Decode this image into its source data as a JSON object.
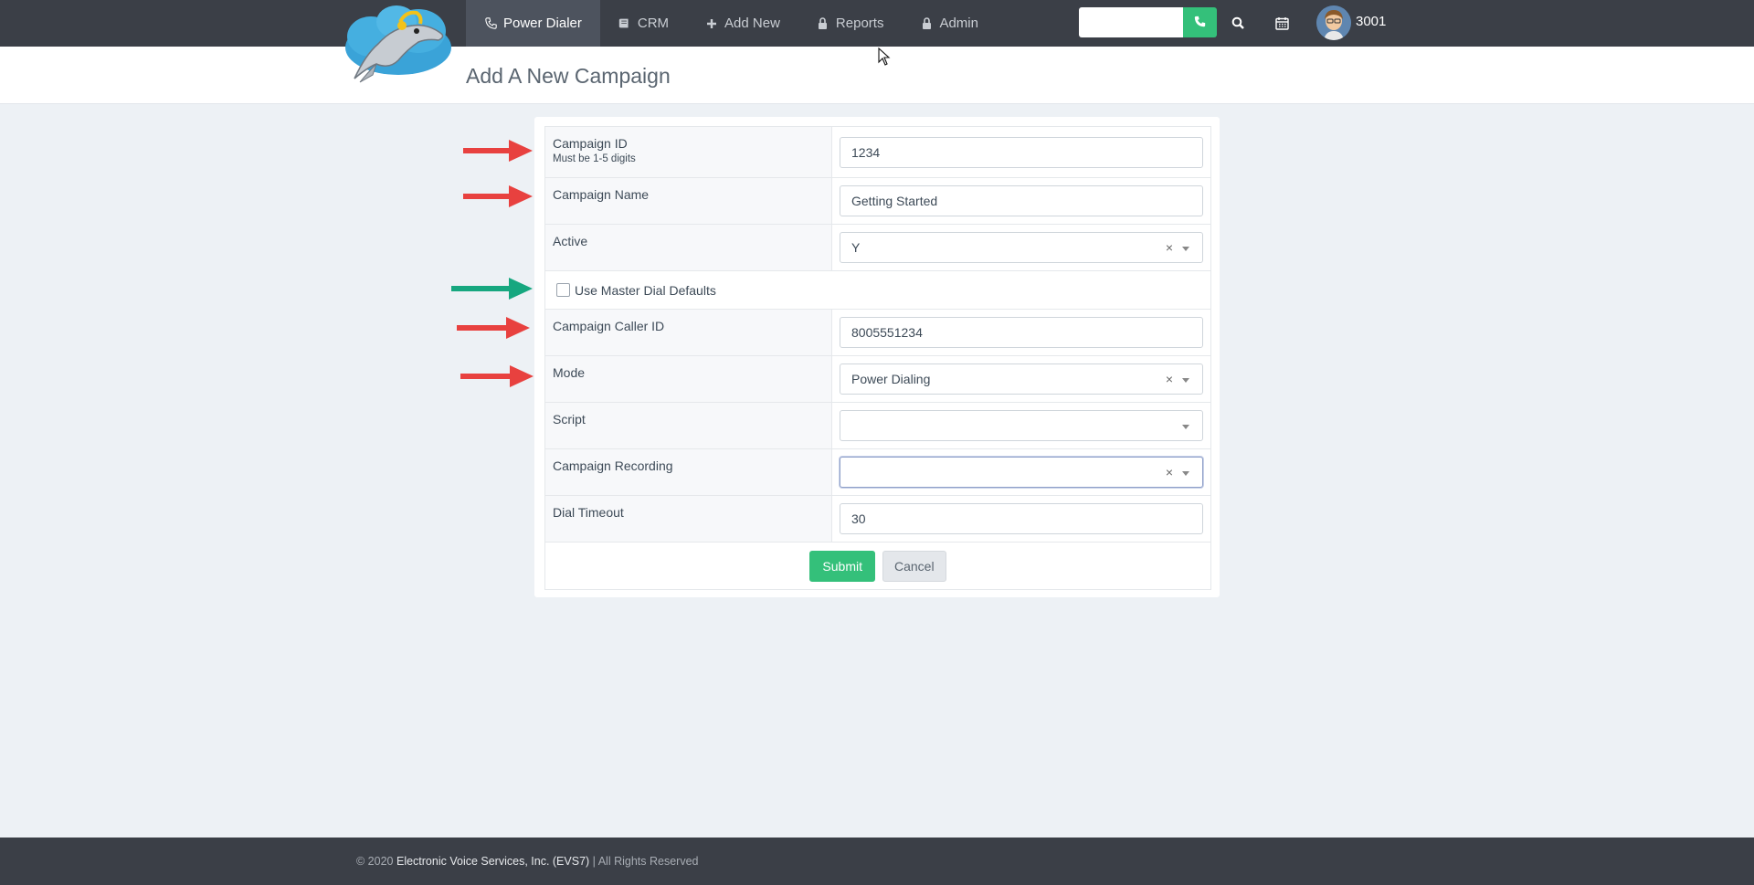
{
  "nav": {
    "items": [
      {
        "label": "Power Dialer",
        "icon": "phone-icon",
        "active": true
      },
      {
        "label": "CRM",
        "icon": "book-icon",
        "active": false
      },
      {
        "label": "Add New",
        "icon": "plus-icon",
        "active": false
      },
      {
        "label": "Reports",
        "icon": "lock-icon",
        "active": false
      },
      {
        "label": "Admin",
        "icon": "lock-icon",
        "active": false
      }
    ],
    "dial_input_value": "",
    "user_extension": "3001"
  },
  "page": {
    "title": "Add A New Campaign"
  },
  "form": {
    "campaign_id": {
      "label": "Campaign ID",
      "hint": "Must be 1-5 digits",
      "value": "1234"
    },
    "campaign_name": {
      "label": "Campaign Name",
      "value": "Getting Started"
    },
    "active": {
      "label": "Active",
      "value": "Y"
    },
    "use_master_dial_defaults": {
      "label": "Use Master Dial Defaults",
      "checked": false
    },
    "campaign_caller_id": {
      "label": "Campaign Caller ID",
      "value": "8005551234"
    },
    "mode": {
      "label": "Mode",
      "value": "Power Dialing"
    },
    "script": {
      "label": "Script",
      "value": ""
    },
    "campaign_recording": {
      "label": "Campaign Recording",
      "value": ""
    },
    "dial_timeout": {
      "label": "Dial Timeout",
      "value": "30"
    },
    "clear_symbol": "×",
    "submit_label": "Submit",
    "cancel_label": "Cancel"
  },
  "annotations": {
    "arrow_colors": {
      "red": "#e8413f",
      "green": "#16a77f"
    }
  },
  "footer": {
    "prefix": "© 2020",
    "company": "Electronic Voice Services, Inc. (EVS7)",
    "suffix": "| All Rights Reserved"
  },
  "colors": {
    "topbar": "#3b3f47",
    "accent_green": "#34c07a",
    "page_background": "#edf1f5"
  }
}
